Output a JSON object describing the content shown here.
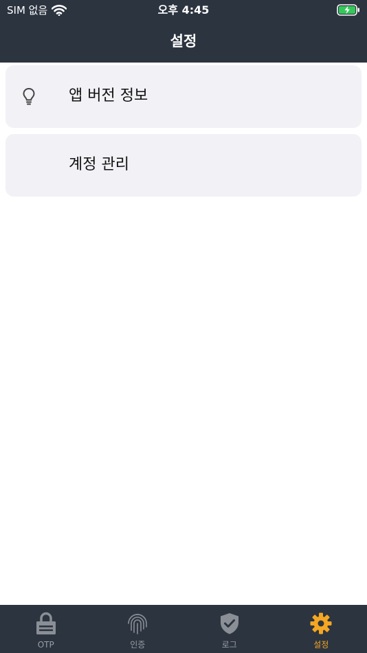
{
  "status_bar": {
    "carrier": "SIM 없음",
    "time": "오후 4:45",
    "icons": [
      "wifi-icon",
      "battery-charging-icon"
    ]
  },
  "nav": {
    "title": "설정"
  },
  "menu": {
    "items": [
      {
        "label": "앱 버전 정보",
        "icon": "lightbulb-icon"
      },
      {
        "label": "계정 관리",
        "icon": ""
      }
    ]
  },
  "tabbar": {
    "tabs": [
      {
        "label": "OTP",
        "icon": "lock-icon",
        "active": false
      },
      {
        "label": "인증",
        "icon": "fingerprint-icon",
        "active": false
      },
      {
        "label": "로그",
        "icon": "shield-check-icon",
        "active": false
      },
      {
        "label": "설정",
        "icon": "gear-icon",
        "active": true
      }
    ]
  },
  "colors": {
    "bar_background": "#2c3440",
    "active_tab": "#f5a623",
    "inactive_tab": "#9a9fa6",
    "card_background": "#f1f1f6",
    "battery_charge": "#34c759"
  }
}
